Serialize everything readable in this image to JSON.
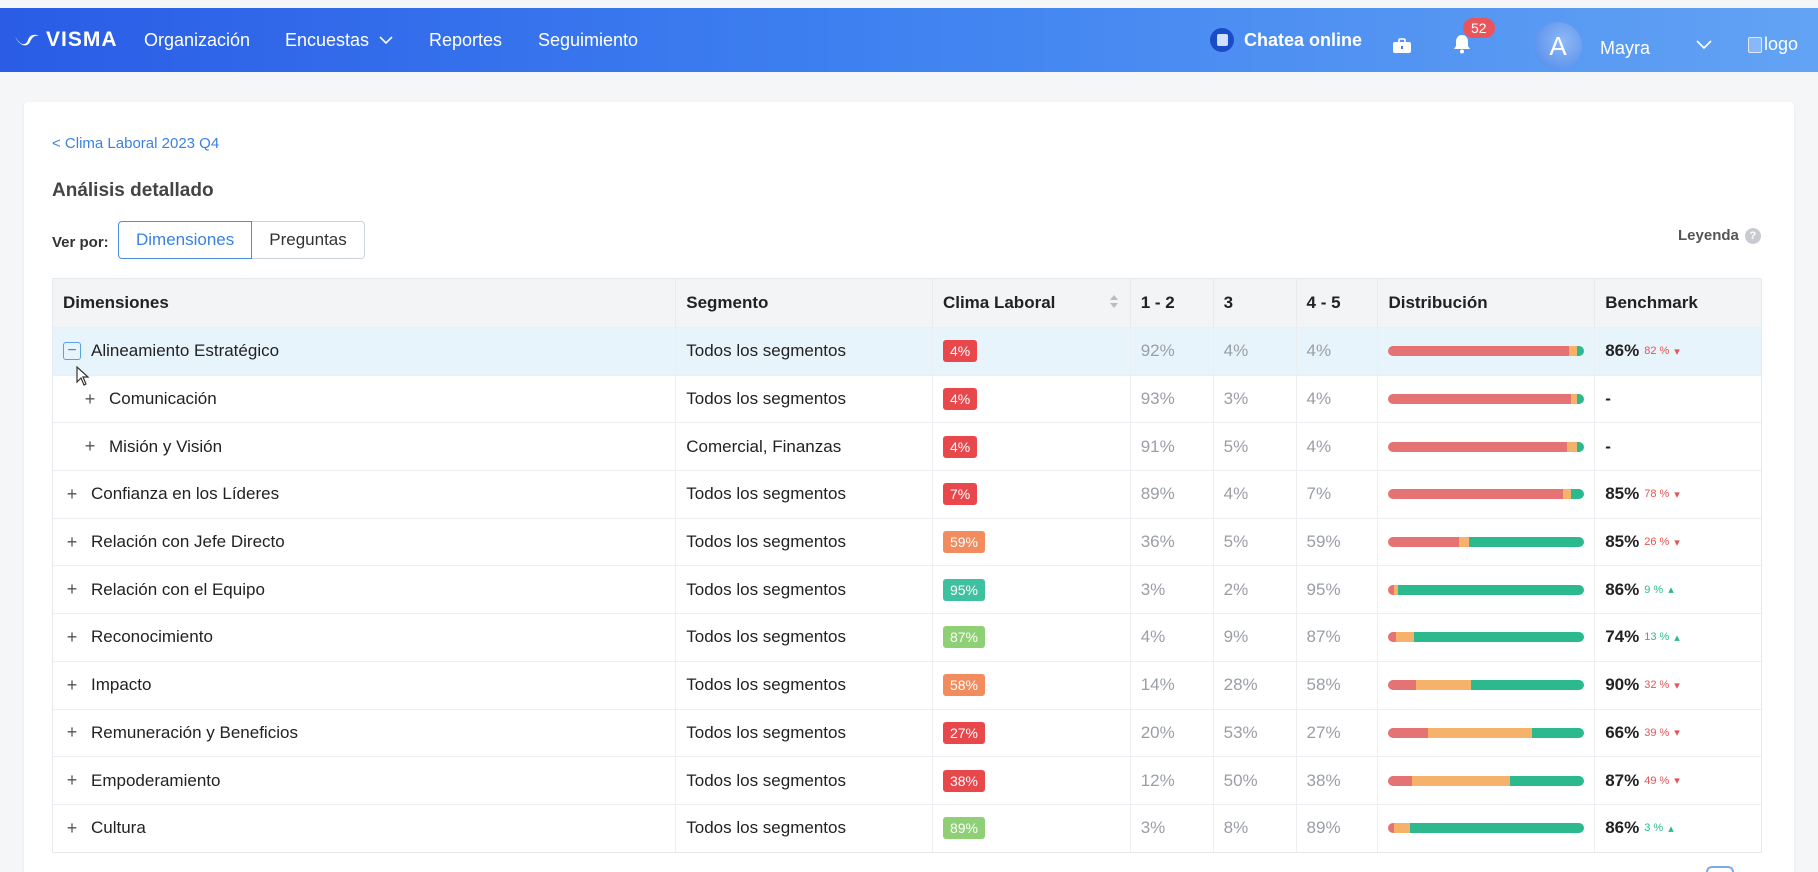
{
  "brand": "VISMA",
  "nav": [
    {
      "label": "Organización",
      "has_chevron": false
    },
    {
      "label": "Encuestas",
      "has_chevron": true
    },
    {
      "label": "Reportes",
      "has_chevron": false
    },
    {
      "label": "Seguimiento",
      "has_chevron": false
    }
  ],
  "header": {
    "chat_label": "Chatea online",
    "notifications_count": "52",
    "avatar_initial": "A",
    "user_name": "Mayra",
    "logo_alt": "logo"
  },
  "breadcrumb": "< Clima Laboral 2023 Q4",
  "section_title": "Análisis detallado",
  "view_by": {
    "label": "Ver por:",
    "options": [
      "Dimensiones",
      "Preguntas"
    ],
    "selected": "Dimensiones"
  },
  "legend_label": "Leyenda",
  "legend_icon": "?",
  "colors": {
    "low": "#e57373",
    "mid": "#f5b26b",
    "high": "#2bb98d",
    "pill_red": "#e8474c",
    "pill_orange": "#f28b5e",
    "pill_teal": "#3fc0a0",
    "pill_green": "#8fcf75",
    "down": "#e55353",
    "up": "#2bb98d"
  },
  "table": {
    "headers": [
      "Dimensiones",
      "Segmento",
      "Clima Laboral",
      "1 - 2",
      "3",
      "4 - 5",
      "Distribución",
      "Benchmark"
    ],
    "rows": [
      {
        "name": "Alineamiento Estratégico",
        "toggle": "−",
        "level": 0,
        "highlight": true,
        "segment": "Todos los segmentos",
        "clima": "4%",
        "pill": "pill_red",
        "low": "92%",
        "mid": "4%",
        "high": "4%",
        "dist": [
          92,
          4,
          4
        ],
        "bench": "86%",
        "bench_delta": "82 %",
        "trend": "down"
      },
      {
        "name": "Comunicación",
        "toggle": "+",
        "level": 1,
        "highlight": false,
        "segment": "Todos los segmentos",
        "clima": "4%",
        "pill": "pill_red",
        "low": "93%",
        "mid": "3%",
        "high": "4%",
        "dist": [
          93,
          3,
          4
        ],
        "bench": "-",
        "bench_delta": "",
        "trend": ""
      },
      {
        "name": "Misión y Visión",
        "toggle": "+",
        "level": 1,
        "highlight": false,
        "segment": "Comercial, Finanzas",
        "clima": "4%",
        "pill": "pill_red",
        "low": "91%",
        "mid": "5%",
        "high": "4%",
        "dist": [
          91,
          5,
          4
        ],
        "bench": "-",
        "bench_delta": "",
        "trend": ""
      },
      {
        "name": "Confianza en los Líderes",
        "toggle": "+",
        "level": 0,
        "highlight": false,
        "segment": "Todos los segmentos",
        "clima": "7%",
        "pill": "pill_red",
        "low": "89%",
        "mid": "4%",
        "high": "7%",
        "dist": [
          89,
          4,
          7
        ],
        "bench": "85%",
        "bench_delta": "78 %",
        "trend": "down"
      },
      {
        "name": "Relación con Jefe Directo",
        "toggle": "+",
        "level": 0,
        "highlight": false,
        "segment": "Todos los segmentos",
        "clima": "59%",
        "pill": "pill_orange",
        "low": "36%",
        "mid": "5%",
        "high": "59%",
        "dist": [
          36,
          5,
          59
        ],
        "bench": "85%",
        "bench_delta": "26 %",
        "trend": "down"
      },
      {
        "name": "Relación con el Equipo",
        "toggle": "+",
        "level": 0,
        "highlight": false,
        "segment": "Todos los segmentos",
        "clima": "95%",
        "pill": "pill_teal",
        "low": "3%",
        "mid": "2%",
        "high": "95%",
        "dist": [
          3,
          2,
          95
        ],
        "bench": "86%",
        "bench_delta": "9 %",
        "trend": "up"
      },
      {
        "name": "Reconocimiento",
        "toggle": "+",
        "level": 0,
        "highlight": false,
        "segment": "Todos los segmentos",
        "clima": "87%",
        "pill": "pill_green",
        "low": "4%",
        "mid": "9%",
        "high": "87%",
        "dist": [
          4,
          9,
          87
        ],
        "bench": "74%",
        "bench_delta": "13 %",
        "trend": "up"
      },
      {
        "name": "Impacto",
        "toggle": "+",
        "level": 0,
        "highlight": false,
        "segment": "Todos los segmentos",
        "clima": "58%",
        "pill": "pill_orange",
        "low": "14%",
        "mid": "28%",
        "high": "58%",
        "dist": [
          14,
          28,
          58
        ],
        "bench": "90%",
        "bench_delta": "32 %",
        "trend": "down"
      },
      {
        "name": "Remuneración y Beneficios",
        "toggle": "+",
        "level": 0,
        "highlight": false,
        "segment": "Todos los segmentos",
        "clima": "27%",
        "pill": "pill_red",
        "low": "20%",
        "mid": "53%",
        "high": "27%",
        "dist": [
          20,
          53,
          27
        ],
        "bench": "66%",
        "bench_delta": "39 %",
        "trend": "down"
      },
      {
        "name": "Empoderamiento",
        "toggle": "+",
        "level": 0,
        "highlight": false,
        "segment": "Todos los segmentos",
        "clima": "38%",
        "pill": "pill_red",
        "low": "12%",
        "mid": "50%",
        "high": "38%",
        "dist": [
          12,
          50,
          38
        ],
        "bench": "87%",
        "bench_delta": "49 %",
        "trend": "down"
      },
      {
        "name": "Cultura",
        "toggle": "+",
        "level": 0,
        "highlight": false,
        "segment": "Todos los segmentos",
        "clima": "89%",
        "pill": "pill_green",
        "low": "3%",
        "mid": "8%",
        "high": "89%",
        "dist": [
          3,
          8,
          89
        ],
        "bench": "86%",
        "bench_delta": "3 %",
        "trend": "up"
      }
    ]
  }
}
